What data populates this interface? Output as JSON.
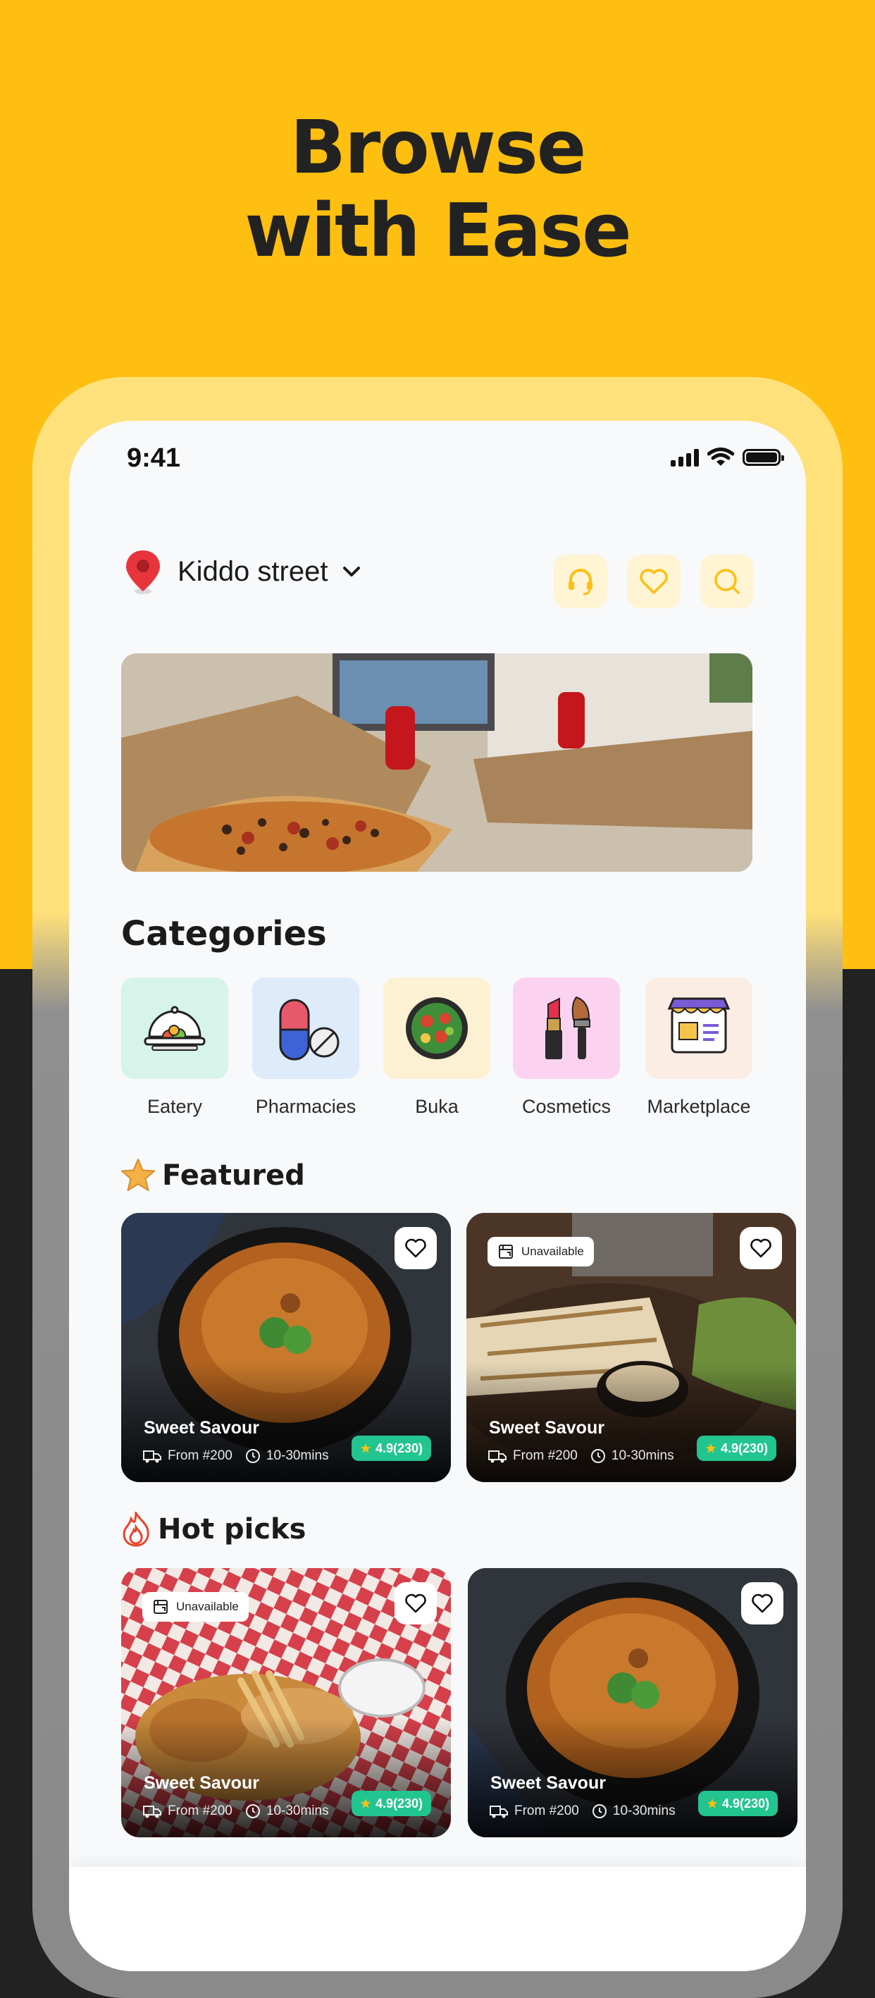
{
  "hero": {
    "line1": "Browse",
    "line2": "with Ease"
  },
  "status_bar": {
    "time": "9:41"
  },
  "header": {
    "location": "Kiddo street"
  },
  "sections": {
    "categories": "Categories",
    "featured": "Featured",
    "hot_picks": "Hot picks"
  },
  "categories": [
    {
      "label": "Eatery",
      "bg": "#D7F4EA"
    },
    {
      "label": "Pharmacies",
      "bg": "#DDEBFA"
    },
    {
      "label": "Buka",
      "bg": "#FCF1D2"
    },
    {
      "label": "Cosmetics",
      "bg": "#FBD3F0"
    },
    {
      "label": "Marketplace",
      "bg": "#FBEDE3"
    }
  ],
  "featured": [
    {
      "name": "Sweet Savour",
      "price": "From #200",
      "time": "10-30mins",
      "rating": "4.9(230)",
      "badge": ""
    },
    {
      "name": "Sweet Savour",
      "price": "From #200",
      "time": "10-30mins",
      "rating": "4.9(230)",
      "badge": "Unavailable"
    }
  ],
  "hot_picks": [
    {
      "name": "Sweet Savour",
      "price": "From #200",
      "time": "10-30mins",
      "rating": "4.9(230)",
      "badge": "Unavailable"
    },
    {
      "name": "Sweet Savour",
      "price": "From #200",
      "time": "10-30mins",
      "rating": "4.9(230)",
      "badge": ""
    }
  ],
  "colors": {
    "brand_yellow": "#FEBF10",
    "rating_green": "#22C58F",
    "dark_bg": "#222223"
  }
}
